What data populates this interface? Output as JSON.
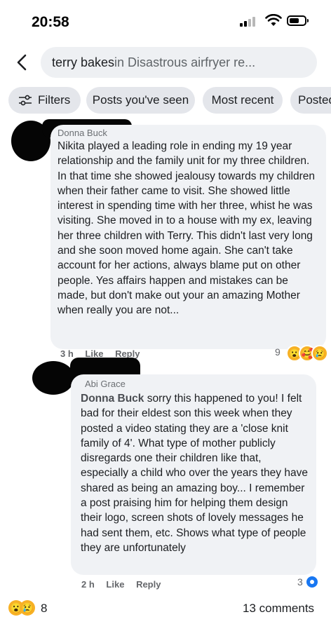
{
  "status": {
    "time": "20:58"
  },
  "search": {
    "query": "terry bakes",
    "context": " in Disastrous airfryer re..."
  },
  "chips": [
    "Filters",
    "Posts you've seen",
    "Most recent",
    "Posted"
  ],
  "comments": [
    {
      "author": "Donna Buck",
      "text": "Nikita played a leading role in ending my 19 year relationship and the family unit for my three children. In that time she showed jealousy towards my children when their father came to visit. She showed little interest in spending time with her three, whist he was visiting. She moved in to a house with my ex, leaving her three children with Terry. This didn't last very long and she soon moved home again. She can't take account for her actions,  always blame put on other people. Yes affairs happen and mistakes can be made, but don't make out your an amazing Mother when really you are not...",
      "time": "3 h",
      "like": "Like",
      "reply": "Reply",
      "reactions": "9",
      "reaction_icons": [
        "wow-icon",
        "care-icon",
        "sad-icon"
      ]
    },
    {
      "author": "Abi Grace",
      "mention": "Donna Buck",
      "text": "sorry this happened to you! I felt bad for their eldest son this week when they posted a video stating they are a 'close knit family of 4'. What type of mother publicly disregards one their children like that, especially a child who over the years they have shared as being an amazing boy... I remember a post praising him for helping them design their logo, screen shots of lovely messages he had sent them, etc. Shows what type of people they are unfortunately",
      "time": "2 h",
      "like": "Like",
      "reply": "Reply",
      "reactions": "3",
      "reaction_icons": [
        "like-icon"
      ]
    }
  ],
  "footer": {
    "reaction_count": "8",
    "comments": "13 comments",
    "reaction_icons": [
      "wow-icon",
      "sad-icon"
    ]
  },
  "colors": {
    "bubble": "#f0f2f5",
    "chip": "#e4e6eb",
    "meta": "#65676b",
    "like_blue": "#1877f2"
  }
}
